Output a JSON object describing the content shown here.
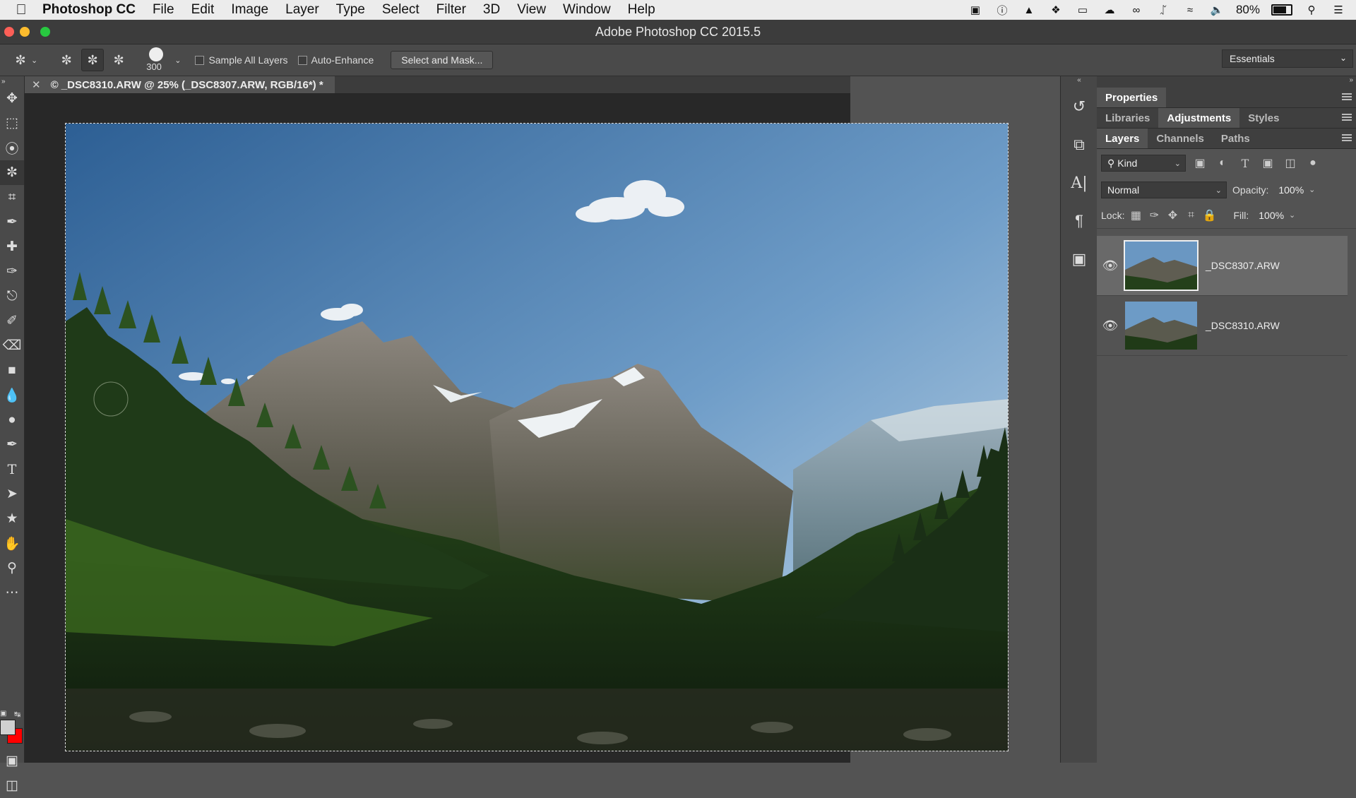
{
  "menubar": {
    "app_name": "Photoshop CC",
    "items": [
      "File",
      "Edit",
      "Image",
      "Layer",
      "Type",
      "Select",
      "Filter",
      "3D",
      "View",
      "Window",
      "Help"
    ],
    "battery": "80%"
  },
  "window": {
    "title": "Adobe Photoshop CC 2015.5"
  },
  "options": {
    "brush_size": "300",
    "sample_all_layers": "Sample All Layers",
    "auto_enhance": "Auto-Enhance",
    "select_and_mask": "Select and Mask...",
    "workspace": "Essentials"
  },
  "document": {
    "tab_title": "© _DSC8310.ARW @ 25% (_DSC8307.ARW, RGB/16*) *"
  },
  "panels": {
    "properties_tab": "Properties",
    "libraries_tab": "Libraries",
    "adjustments_tab": "Adjustments",
    "styles_tab": "Styles",
    "layers_tab": "Layers",
    "channels_tab": "Channels",
    "paths_tab": "Paths",
    "filter_kind": "Kind",
    "blend_mode": "Normal",
    "opacity_label": "Opacity:",
    "opacity_value": "100%",
    "lock_label": "Lock:",
    "fill_label": "Fill:",
    "fill_value": "100%"
  },
  "layers": [
    {
      "name": "_DSC8307.ARW",
      "selected": true
    },
    {
      "name": "_DSC8310.ARW",
      "selected": false
    }
  ],
  "colors": {
    "foreground": "#d0d0d0",
    "background": "#ff0000",
    "accent": "#fc5f57"
  }
}
